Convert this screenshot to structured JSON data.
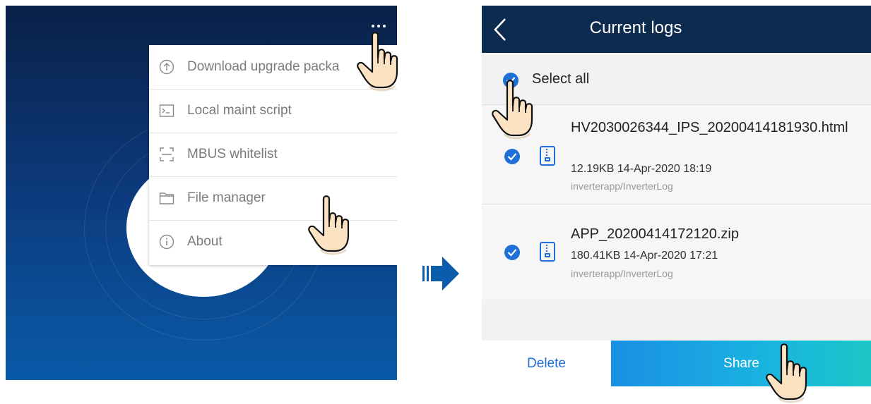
{
  "left_screen": {
    "menu_icon": "more-dots-icon",
    "menu": {
      "items": [
        {
          "label": "Download upgrade packa",
          "icon": "upload-circle-icon"
        },
        {
          "label": "Local maint script",
          "icon": "terminal-icon"
        },
        {
          "label": "MBUS whitelist",
          "icon": "scan-frame-icon"
        },
        {
          "label": "File manager",
          "icon": "folder-icon"
        },
        {
          "label": "About",
          "icon": "info-icon"
        }
      ]
    }
  },
  "arrow_icon": "next-step-arrow-icon",
  "right_screen": {
    "header": {
      "title": "Current logs",
      "back_icon": "chevron-left-icon"
    },
    "select_all": {
      "label": "Select all",
      "checked": true
    },
    "files": [
      {
        "name": "HV2030026344_IPS_20200414181930.html",
        "size": "12.19KB",
        "date": "14-Apr-2020 18:19",
        "path": "inverterapp/InverterLog",
        "checked": true,
        "icon": "zip-file-icon"
      },
      {
        "name": "APP_20200414172120.zip",
        "size": "180.41KB",
        "date": "14-Apr-2020 17:21",
        "path": "inverterapp/InverterLog",
        "checked": true,
        "icon": "zip-file-icon"
      }
    ],
    "actions": {
      "delete_label": "Delete",
      "share_label": "Share"
    }
  },
  "colors": {
    "header_bg": "#0d2a4f",
    "accent": "#1e6fd8",
    "share_gradient_start": "#1a8fe3",
    "share_gradient_end": "#1cc6c6",
    "left_bg_top": "#0a2148",
    "left_bg_bottom": "#0a5aa8"
  },
  "hand_icon": "tap-hand-icon"
}
